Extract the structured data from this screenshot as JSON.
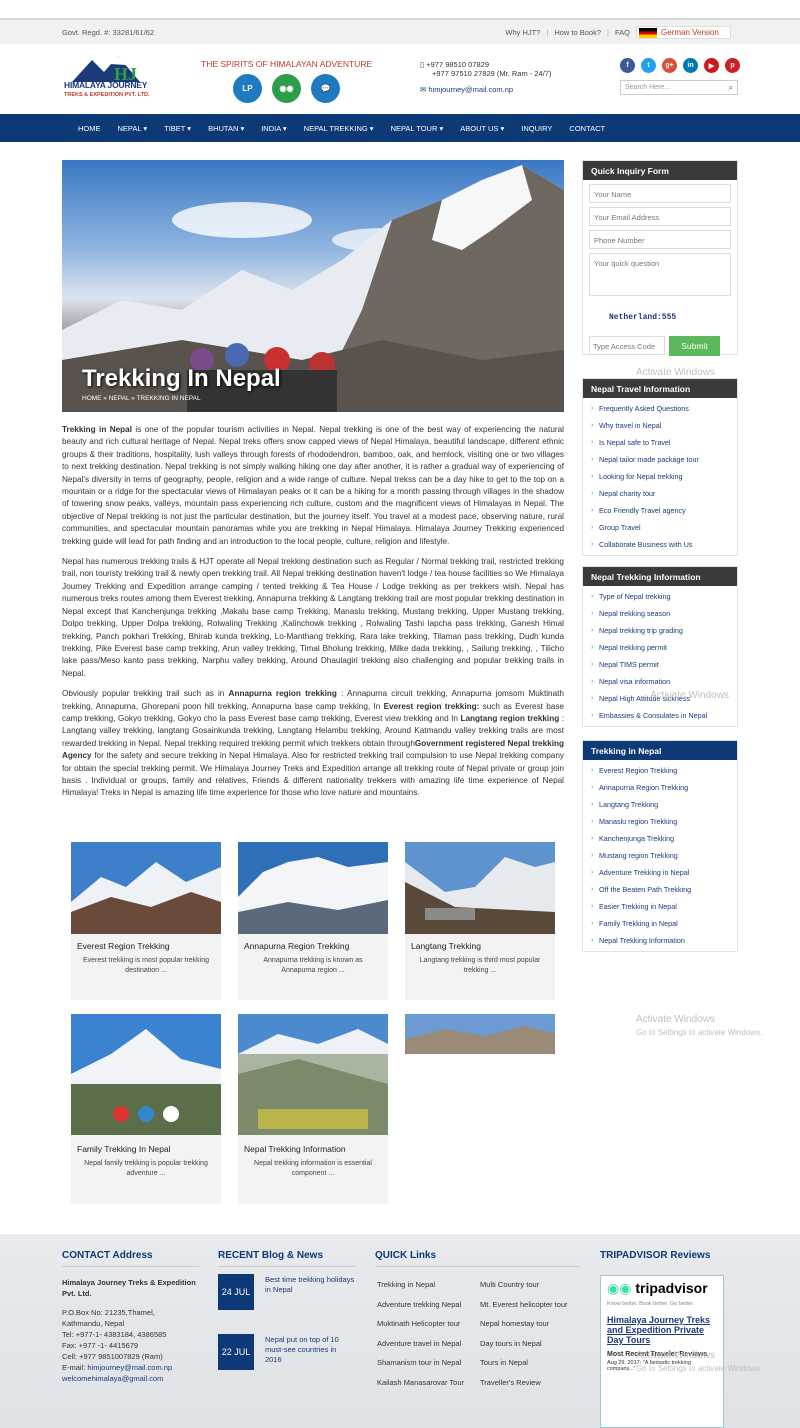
{
  "topbar": {
    "regd": "Govt. Regd. #: 33281/61/62",
    "links": [
      "Why HJT?",
      "How to Book?",
      "FAQ"
    ],
    "lang": "German Version"
  },
  "header": {
    "logo_line1": "HIMALAYA JOURNEY",
    "logo_line2": "TREKS & EXPEDITION PVT. LTD.",
    "tagline": "THE SPIRITS OF HIMALAYAN ADVENTURE",
    "phone1": "+977 98510 07829",
    "phone2": "+977 97510 27829 (Mr. Ram - 24/7)",
    "email": "himjourney@mail.com.np",
    "search_placeholder": "Search Here..."
  },
  "nav": [
    "HOME",
    "NEPAL ▾",
    "TIBET ▾",
    "BHUTAN ▾",
    "INDIA ▾",
    "NEPAL TREKKING ▾",
    "NEPAL TOUR ▾",
    "ABOUT US ▾",
    "INQUIRY",
    "CONTACT"
  ],
  "hero": {
    "title": "Trekking In Nepal",
    "breadcrumb": "HOME » NEPAL » TREKKING IN NEPAL"
  },
  "article": {
    "p1_bold": "Trekking in Nepal",
    "p1": " is one of the popular tourism activities in Nepal. Nepal trekking is one of the best way of experiencing the natural beauty and rich cultural heritage of Nepal. Nepal treks offers snow capped views of Nepal Himalaya, beautiful landscape, different ethnic groups & their traditions, hospitality, lush valleys through forests of rhododendron, bamboo, oak, and hemlock, visiting one or two villages to next trekking destination. Nepal trekking is not simply walking hiking one day after another, it is rather a gradual way of experiencing of Nepal's diversity in terns of geography, people, religion and a wide range of culture. Nepal trekss can be a day hike to get to the top on a mountain or a ridge for the spectacular views of Himalayan peaks or it can be a hiking for a month passing through villages in the shadow of towering snow peaks, valleys, mountain pass experiencing rich culture, custom and the magnificent views of Himalayas in Nepal. The objective of Nepal trekking is not just the particular destination, but the journey itself. You travel at a modest pace, observing nature, rural communities, and spectacular mountain panoramas while you are trekking in Nepal Himalaya. Himalaya Journey Trekking experienced trekking guide will lead for path finding and an introduction to the local people, culture, religion and lifestyle.",
    "p2": "Nepal has numerous trekking trails & HJT operate all Nepal trekking destination such as Regular / Normal trekking trail, restricted trekking trail, non touristy trekking trail & newly open trekking trail. All Nepal trekking destination haven't lodge / tea house facilities so We Himalaya Journey Trekking and Expedition arrange camping / tented trekking & Tea House / Lodge trekking as per trekkers wish. Nepal has numerous treks routes among them Everest trekking, Annapurna trekking & Langtang trekking trail are most popular trekking destination in Nepal except that Kanchenjunga trekking ,Makalu base camp Trekking, Manaslu trekking, Mustang trekking, Upper Mustang trekking, Dolpo trekking, Upper Dolpa trekking, Rolwaling Trekking ,Kalinchowk trekking , Rolwaling Tashi lapcha pass trekking, Ganesh Himal trekking, Panch pokhari Trekking, Bhirab kunda trekking, Lo-Manthang trekking, Rara lake trekking, Tilaman pass trekking, Dudh kunda trekking, Pike Everest base camp trekking, Arun valley trekking, Timal Bholung trekking, Milke dada trekking, , Sailung trekking, , Tilicho lake pass/Meso kanto pass trekking, Narphu valley trekking, Around Dhaulagiri trekking also challenging and popular trekking trails in Nepal.",
    "p3a": "Obviously popular trekking trail such as in ",
    "p3b": "Annapurna region trekking",
    "p3c": " : Annapurna circuit trekking, Annapurna jomsom Muktinath trekking, Annapurna, Ghorepani poon hill trekking, Annapurna base camp trekking, In ",
    "p3d": "Everest region trekking:",
    "p3e": " such as Everest base camp trekking, Gokyo trekking, Gokyo cho la pass Everest base camp trekking, Everest view trekking and In ",
    "p3f": "Langtang region trekking",
    "p3g": " : Langtang valley trekking, langtang Gosainkunda trekking, Langtang Helambu trekking, Around Katmandu valley trekking trails are most rewarded trekking in Nepal. Nepal trekking required trekking permit which trekkers obtain through",
    "p3h": "Government registered Nepal trekking Agency",
    "p3i": " for the safety and secure trekking in Nepal Himalaya. Also for restricted trekking trail compulsion to use Nepal trekking company for obtain the special trekking permit. We Himalaya Journey Treks and Expedition arrange all trekking route of Nepal private or group join basis . Individual or groups, family and relatives, Friends & different nationality trekkers with amazing life time experience of Nepal Himalaya! Treks in Nepal is amazing life time experience for those who love nature and mountains."
  },
  "cards": [
    {
      "title": "Everest Region Trekking",
      "desc": "Everest trekking is most popular trekking destination ..."
    },
    {
      "title": "Annapurna Region Trekking",
      "desc": "Annapurna trekking is known as Annapurna region ..."
    },
    {
      "title": "Langtang Trekking",
      "desc": "Langtang trekking is third most popular trekking ..."
    },
    {
      "title": "Family Trekking In Nepal",
      "desc": "Nepal family trekking is popular trekking adventure ..."
    },
    {
      "title": "Nepal Trekking Information",
      "desc": "Nepal trekking information is essential component ..."
    }
  ],
  "inquiry": {
    "title": "Quick Inquiry Form",
    "name": "Your Name",
    "email": "Your Email Address",
    "phone": "Phone Number",
    "question": "Your quick question",
    "captcha_text": "Netherland:555",
    "access": "Type Access Code",
    "submit": "Submit"
  },
  "travel_info": {
    "title": "Nepal Travel Information",
    "items": [
      "Frequently Asked Questions",
      "Why travel in Nepal",
      "Is Nepal safe to Travel",
      "Nepal tailor made package tour",
      "Looking for Nepal trekking",
      "Nepal charity tour",
      "Eco Friendly Travel agency",
      "Group Travel",
      "Collaborate Business with Us"
    ]
  },
  "trek_info": {
    "title": "Nepal Trekking Information",
    "items": [
      "Type of Nepal trekking",
      "Nepal trekking season",
      "Nepal trekking trip grading",
      "Nepal trekking permit",
      "Nepal TIMS permit",
      "Nepal visa information",
      "Nepal High Attitude sickness",
      "Embassies & Consulates in Nepal"
    ]
  },
  "trekking_nepal": {
    "title": "Trekking in Nepal",
    "items": [
      "Everest Region Trekking",
      "Annapurna Region Trekking",
      "Langtang Trekking",
      "Manaslu region Trekking",
      "Kanchenjunga Trekking",
      "Mustang region Trekking",
      "Adventure Trekking in Nepal",
      "Off the Beaten Path Trekking",
      "Easier Trekking in Nepal",
      "Family Trekking in Nepal",
      "Nepal Trekking Information"
    ]
  },
  "watermark": {
    "w1": "Activate Windows",
    "w2": "Activate Windows",
    "w3": "Go to Settings to activate Windows.",
    "w4": "Activate Windows",
    "w5": "Go to Settings to activate Windows."
  },
  "footer": {
    "contact_title": "CONTACT Address",
    "company": "Himalaya Journey Treks & Expedition Pvt. Ltd.",
    "addr1": "P.O.Box No: 21235,Thamel,",
    "addr2": "Kathmandu, Nepal",
    "tel": "Tel: +977-1- 4383184, 4386585",
    "fax": "Fax: +977 -1- 4415679",
    "cell": "Cell: +977 9851007829 (Ram)",
    "email_label": "E-mail: ",
    "email1": "himjourney@mail.com.np",
    "email2": "welcomehimalaya@gmail.com",
    "blog_title": "RECENT Blog & News",
    "blog": [
      {
        "date": "24 JUL",
        "title": "Best time trekking holidays in Nepal"
      },
      {
        "date": "22 JUL",
        "title": "Nepal put on top of 10 must-see countries in 2016"
      }
    ],
    "quick_title": "QUICK Links",
    "quick_left": [
      "Trekking in Nepal",
      "Adventure trekking Nepal",
      "Muktinath Helicopter tour",
      "Adventure travel in Nepal",
      "Shamanism tour in Nepal",
      "Kailash Manasarovar Tour"
    ],
    "quick_right": [
      "Multi Country tour",
      "Mt. Everest helicopter tour",
      "Nepal homestay tour",
      "Day tours in Nepal",
      "Tours in Nepal",
      "Traveller's Review"
    ],
    "trip_title": "TRIPADVISOR Reviews",
    "trip_logo": "tripadvisor",
    "trip_sub": "Know better. Book better. Go better.",
    "trip_name": "Himalaya Journey Treks and Expedition Private Day Tours",
    "trip_recent": "Most Recent Traveler Reviews",
    "trip_review": "Aug 29, 2017: \"A fantastic trekking company...\""
  }
}
